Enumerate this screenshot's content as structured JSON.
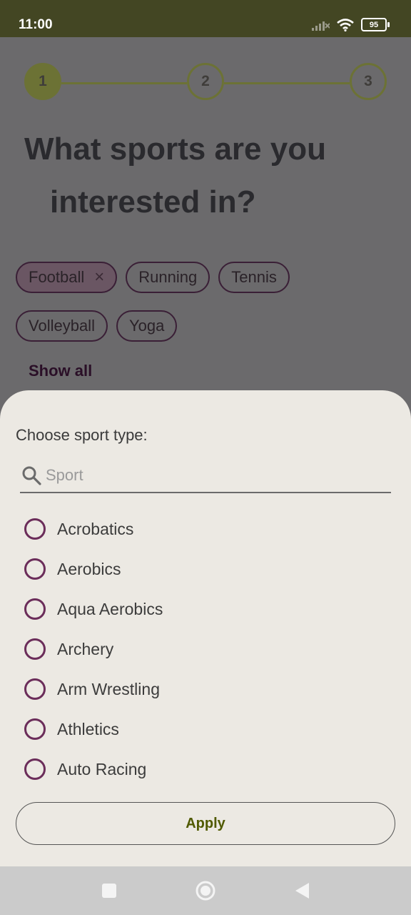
{
  "status": {
    "time": "11:00",
    "battery": "95"
  },
  "stepper": {
    "steps": [
      "1",
      "2",
      "3"
    ]
  },
  "headline": {
    "line1": "What sports are you",
    "line2": "interested in?"
  },
  "chips": {
    "selected": "Football",
    "items": [
      "Running",
      "Tennis",
      "Volleyball",
      "Yoga"
    ],
    "remove_icon": "×",
    "show_all": "Show all"
  },
  "sheet": {
    "title": "Choose sport type:",
    "search_placeholder": "Sport",
    "options": [
      "Acrobatics",
      "Aerobics",
      "Aqua Aerobics",
      "Archery",
      "Arm Wrestling",
      "Athletics",
      "Auto Racing"
    ],
    "apply_label": "Apply"
  },
  "colors": {
    "accent": "#6c7235",
    "radio": "#6b2d5a",
    "apply_text": "#505a00"
  }
}
